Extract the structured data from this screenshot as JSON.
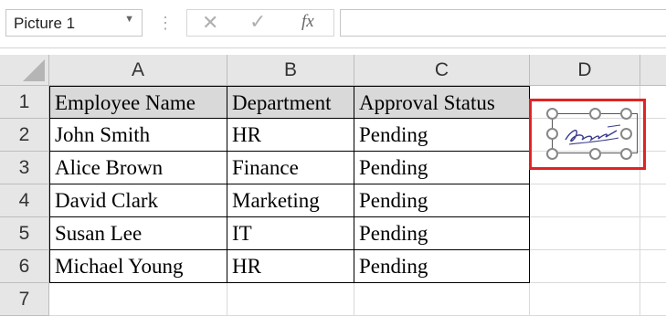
{
  "formula_bar": {
    "namebox_value": "Picture 1",
    "fx_label": "fx",
    "formula_value": ""
  },
  "columns": [
    "A",
    "B",
    "C",
    "D"
  ],
  "rows": [
    "1",
    "2",
    "3",
    "4",
    "5",
    "6",
    "7"
  ],
  "table": {
    "headers": [
      "Employee Name",
      "Department",
      "Approval Status"
    ],
    "records": [
      [
        "John Smith",
        "HR",
        "Pending"
      ],
      [
        "Alice Brown",
        "Finance",
        "Pending"
      ],
      [
        "David Clark",
        "Marketing",
        "Pending"
      ],
      [
        "Susan Lee",
        "IT",
        "Pending"
      ],
      [
        "Michael Young",
        "HR",
        "Pending"
      ]
    ]
  },
  "picture": {
    "name": "Picture 1",
    "content": "signature",
    "highlight_color": "#e02424"
  }
}
